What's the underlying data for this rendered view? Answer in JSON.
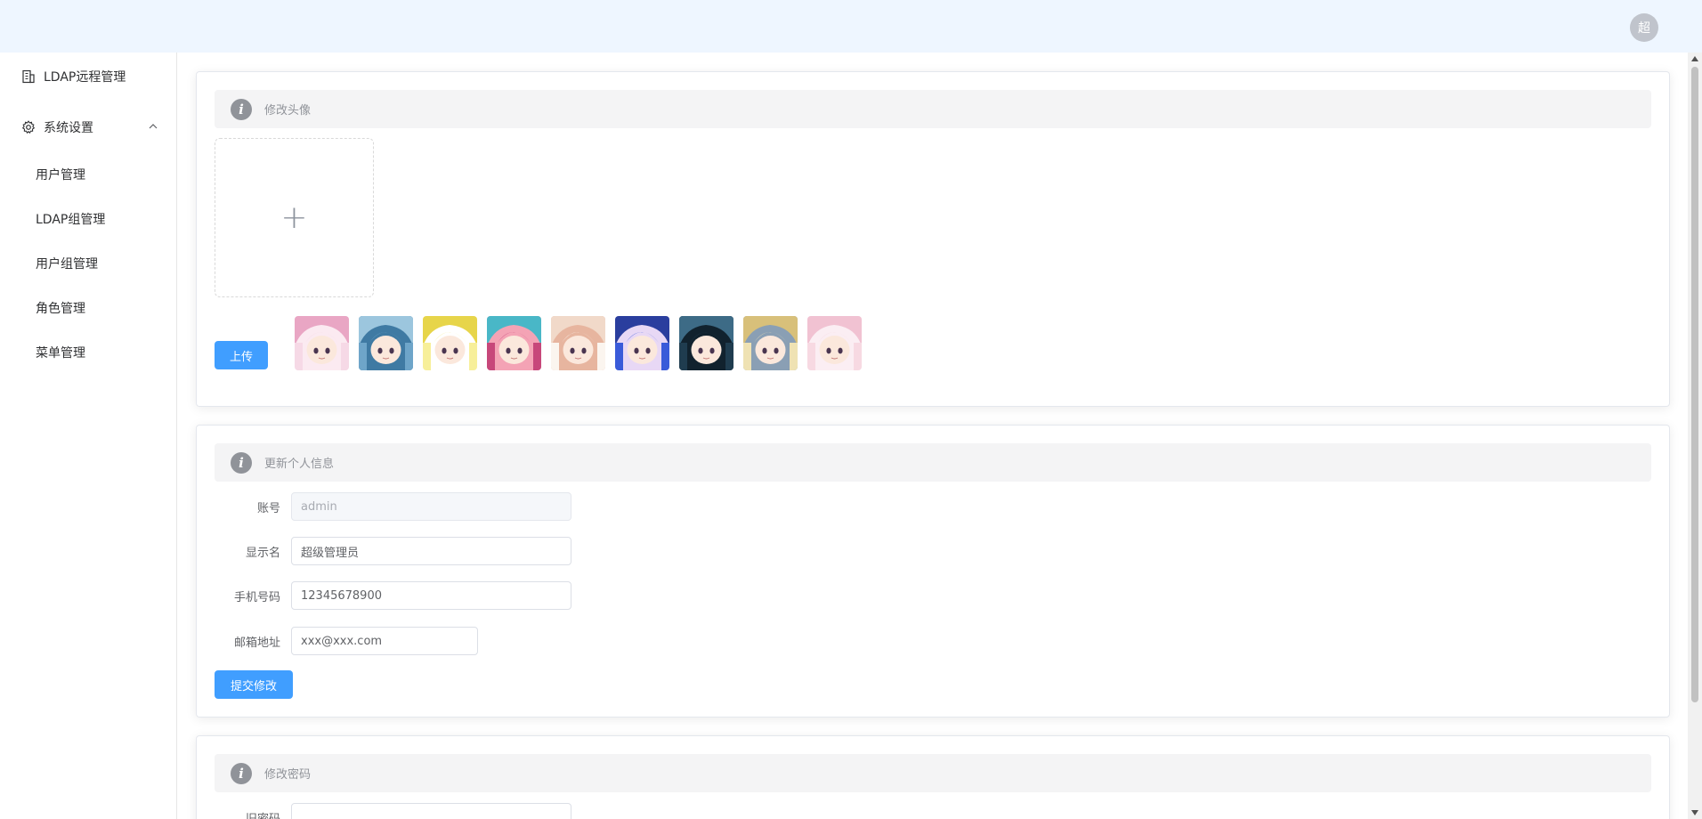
{
  "topbar": {
    "avatar_text": "超"
  },
  "sidebar": {
    "items": [
      {
        "label": "LDAP远程管理",
        "icon": "building-icon"
      },
      {
        "label": "系统设置",
        "icon": "gear-icon",
        "expanded": true
      }
    ],
    "subitems": [
      {
        "label": "用户管理"
      },
      {
        "label": "LDAP组管理"
      },
      {
        "label": "用户组管理"
      },
      {
        "label": "角色管理"
      },
      {
        "label": "菜单管理"
      }
    ]
  },
  "avatar_card": {
    "title": "修改头像",
    "upload_plus": "+",
    "upload_button": "上传",
    "preset_avatars": [
      {
        "name": "pink-hair-girl",
        "colors": [
          "#f6d9e6",
          "#e9a6c4",
          "#fbeaf1"
        ]
      },
      {
        "name": "blue-hair-girl",
        "colors": [
          "#6ea5c9",
          "#9cc6de",
          "#3f7aa3"
        ]
      },
      {
        "name": "blonde-chibi",
        "colors": [
          "#f7ef9a",
          "#e7d54a",
          "#ffffff"
        ]
      },
      {
        "name": "teal-hair-red-bow",
        "colors": [
          "#c7477a",
          "#49b7c7",
          "#f4a3b5"
        ]
      },
      {
        "name": "white-hair-chibi",
        "colors": [
          "#fbf5ef",
          "#f1d9c9",
          "#e7b59f"
        ]
      },
      {
        "name": "blue-oni-girl",
        "colors": [
          "#3a5bd9",
          "#2a3e9e",
          "#e8d8f5"
        ]
      },
      {
        "name": "sunglasses-girl",
        "colors": [
          "#1f3c4f",
          "#3d6b86",
          "#11222e"
        ]
      },
      {
        "name": "blonde-girl",
        "colors": [
          "#efe2b3",
          "#d8c07a",
          "#8a9fb4"
        ]
      },
      {
        "name": "pink-faded-girl",
        "colors": [
          "#f7d9e2",
          "#f1c2d2",
          "#fbeef3"
        ]
      }
    ]
  },
  "profile_card": {
    "title": "更新个人信息",
    "fields": {
      "account": {
        "label": "账号",
        "value": "admin"
      },
      "display_name": {
        "label": "显示名",
        "value": "超级管理员"
      },
      "phone": {
        "label": "手机号码",
        "value": "12345678900"
      },
      "email": {
        "label": "邮箱地址",
        "value": "xxx@xxx.com"
      }
    },
    "submit_button": "提交修改"
  },
  "password_card": {
    "title": "修改密码",
    "old_password_label": "旧密码"
  },
  "colors": {
    "primary": "#409eff",
    "topbar_bg": "#eef6ff",
    "info_icon": "#909399"
  }
}
